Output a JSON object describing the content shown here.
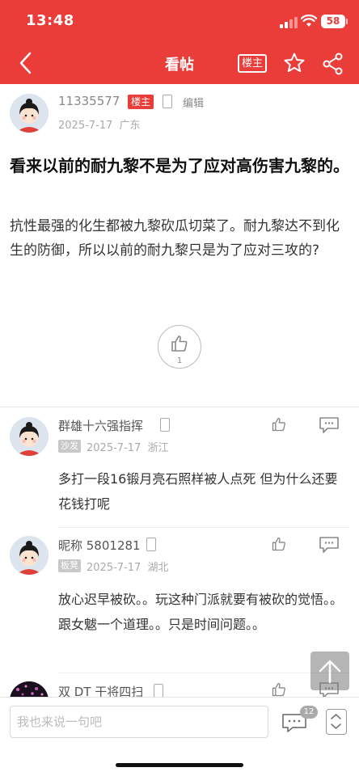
{
  "status_bar": {
    "time": "13:48",
    "battery": "58"
  },
  "nav": {
    "title": "看帖",
    "owner_only_label": "楼主",
    "icons": [
      "back-chevron-icon",
      "star-icon",
      "share-icon"
    ]
  },
  "post": {
    "author": "11335577",
    "owner_badge": "楼主",
    "edit_label": "编辑",
    "date": "2025-7-17",
    "location": "广东",
    "title": "看来以前的耐九黎不是为了应对高伤害九黎的。",
    "body": "抗性最强的化生都被九黎砍瓜切菜了。耐九黎达不到化生的防御，所以以前的耐九黎只是为了应对三攻的?",
    "likes": "1"
  },
  "comments": [
    {
      "name": "群雄十六强指挥",
      "tag": "沙发",
      "date": "2025-7-17",
      "location": "浙江",
      "text": "多打一段16锻月亮石照样被人点死 但为什么还要花钱打呢"
    },
    {
      "name": "昵称 5801281",
      "tag": "板凳",
      "date": "2025-7-17",
      "location": "湖北",
      "text": "放心迟早被砍。。玩这种门派就要有被砍的觉悟。。跟女魃一个道理。。只是时间问题。。"
    },
    {
      "name": "双 DT 干将四扫",
      "tag": "",
      "date": "",
      "location": "",
      "text": ""
    }
  ],
  "bottom_bar": {
    "input_placeholder": "我也来说一句吧",
    "comment_count": "12"
  },
  "colors": {
    "brand_red": "#ea3c39",
    "muted_text": "#aaaaaa"
  }
}
